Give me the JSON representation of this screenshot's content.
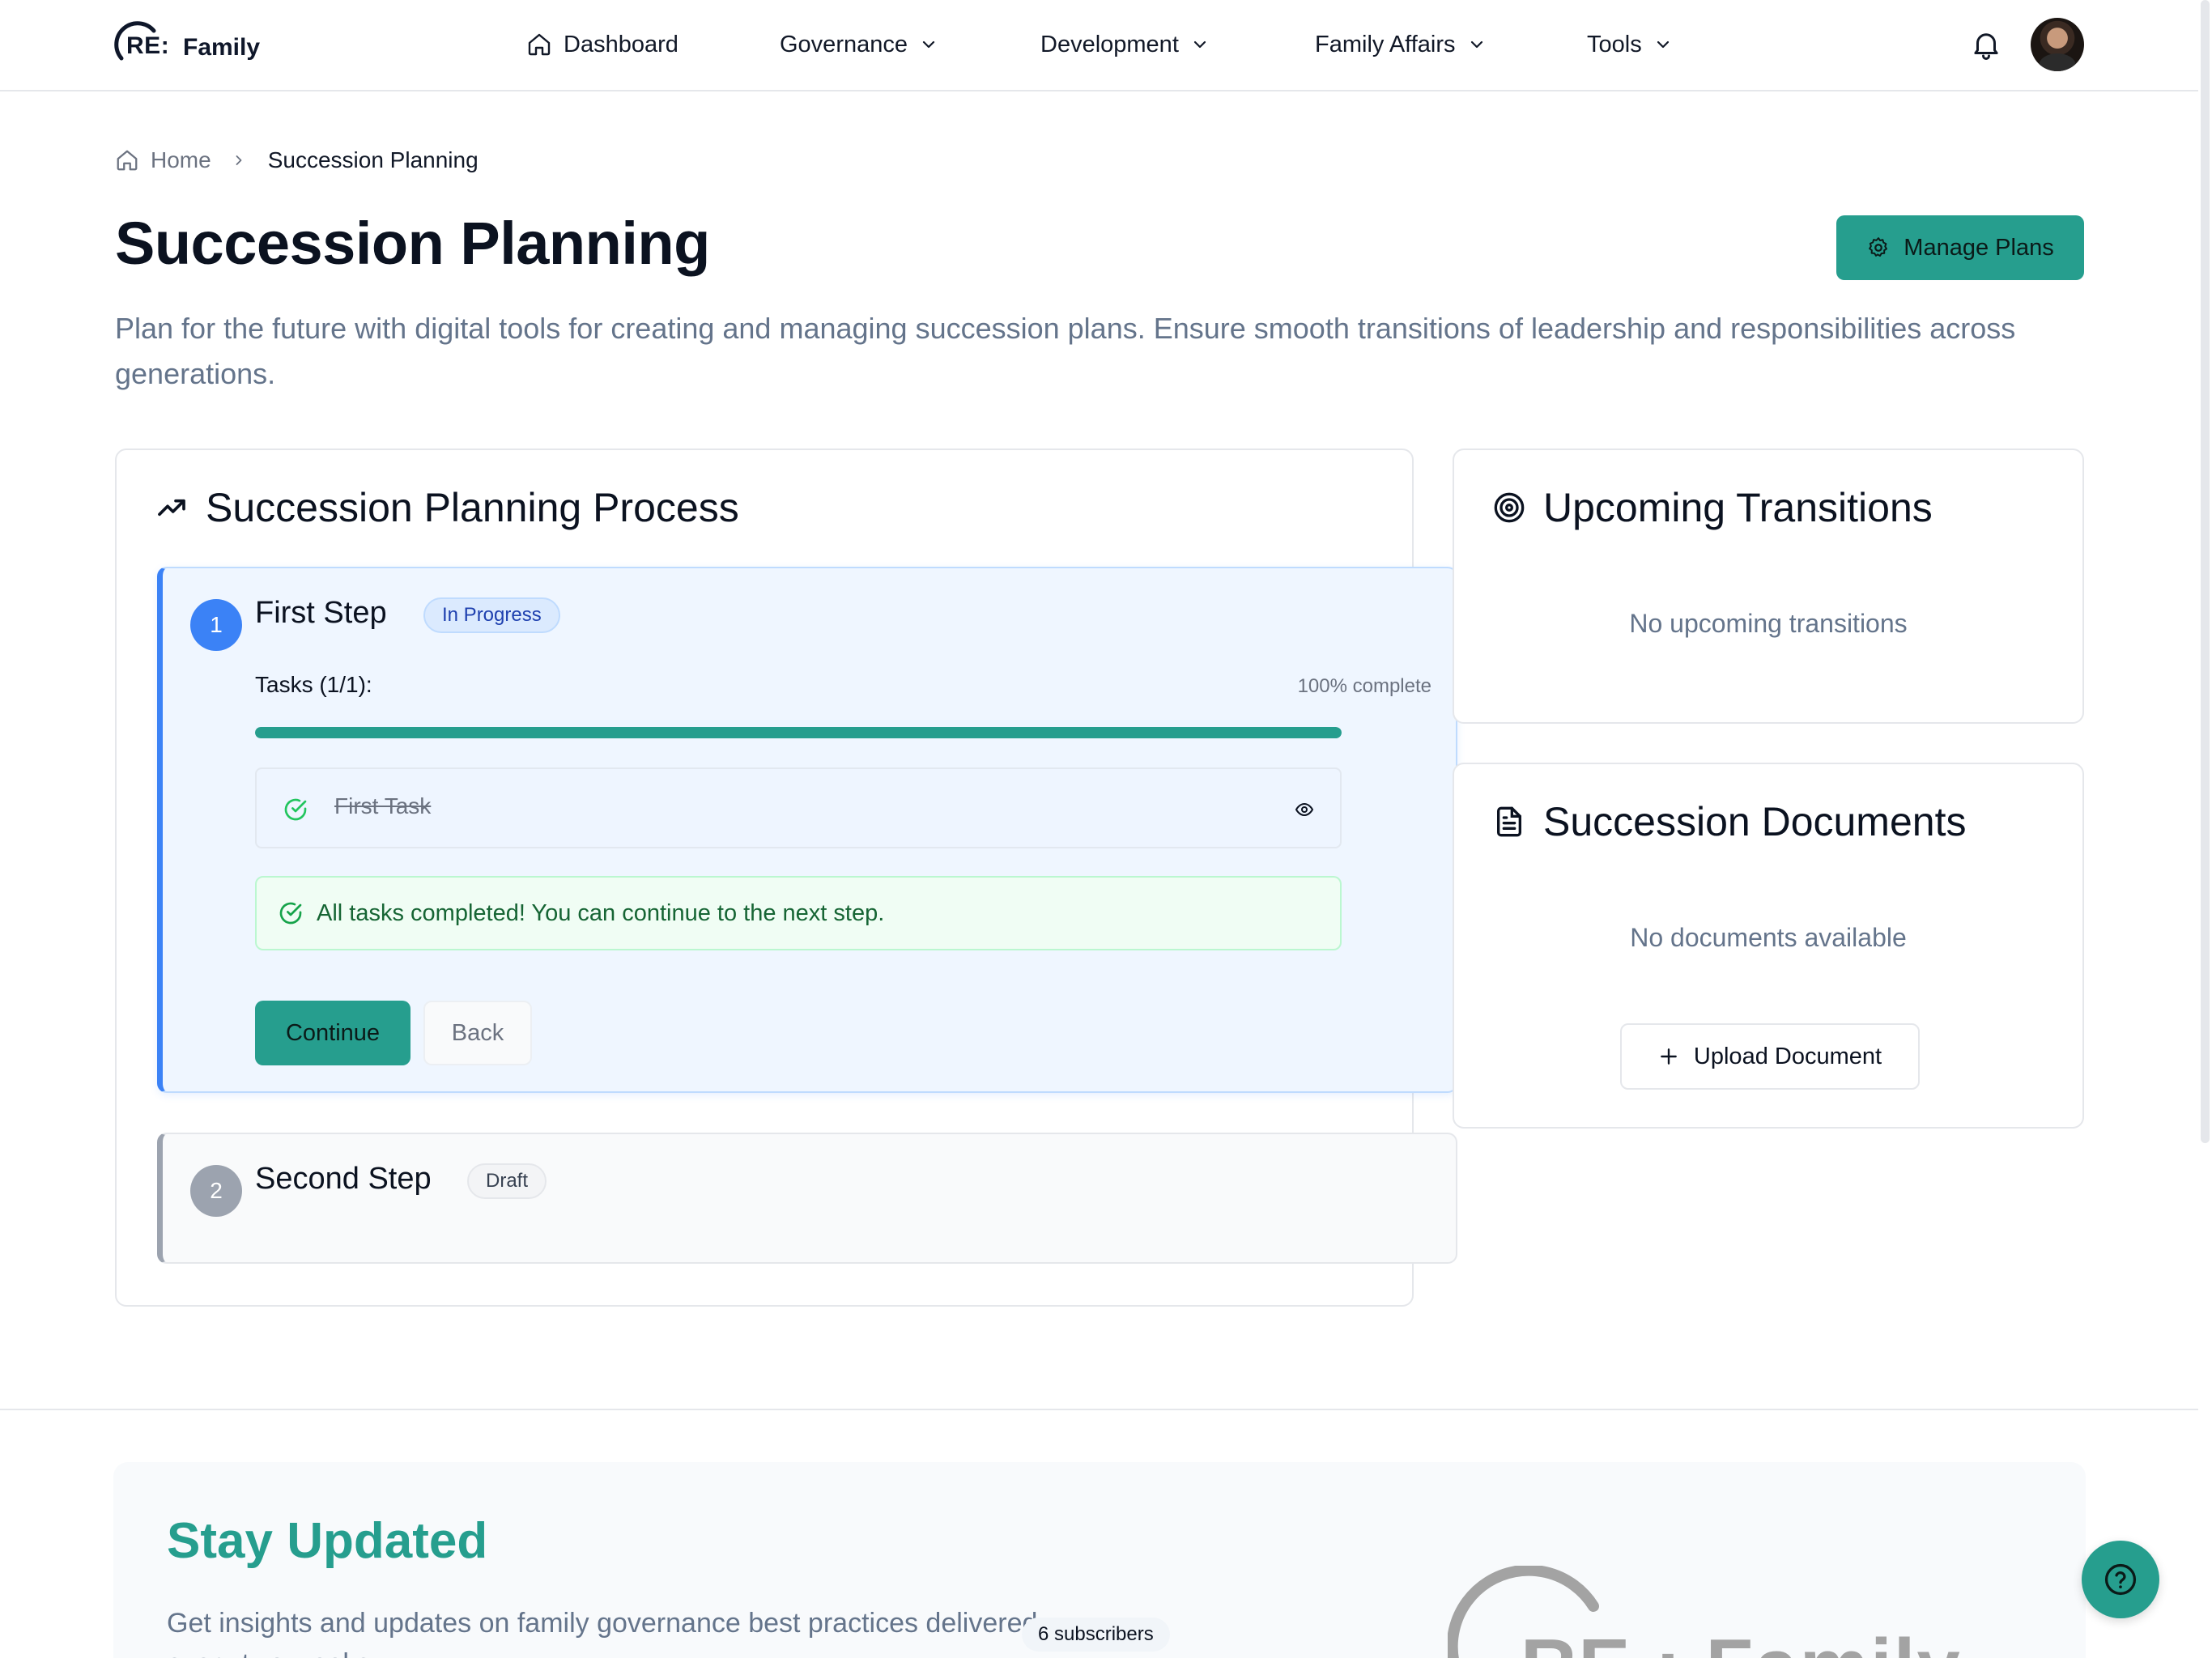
{
  "brand": {
    "re": "RE",
    "colon": ":",
    "family": "Family"
  },
  "nav": {
    "items": [
      {
        "label": "Dashboard",
        "icon": "home-icon"
      },
      {
        "label": "Governance",
        "icon": "chevron-down-icon"
      },
      {
        "label": "Development",
        "icon": "chevron-down-icon"
      },
      {
        "label": "Family Affairs",
        "icon": "chevron-down-icon"
      },
      {
        "label": "Tools",
        "icon": "chevron-down-icon"
      }
    ],
    "notifications_icon": "bell-icon",
    "avatar_icon": "user-avatar"
  },
  "breadcrumb": {
    "home": "Home",
    "current": "Succession Planning"
  },
  "page": {
    "title": "Succession Planning",
    "description": "Plan for the future with digital tools for creating and managing succession plans. Ensure smooth transitions of leadership and responsibilities across generations.",
    "manage_button": "Manage Plans"
  },
  "process": {
    "title": "Succession Planning Process",
    "steps": [
      {
        "number": "1",
        "title": "First Step",
        "status": "In Progress",
        "tasks_label": "Tasks (1/1):",
        "complete_label": "100% complete",
        "progress": 1.0,
        "tasks": [
          {
            "name": "First Task",
            "completed": true
          }
        ],
        "notice": "All tasks completed! You can continue to the next step.",
        "continue_label": "Continue",
        "back_label": "Back"
      },
      {
        "number": "2",
        "title": "Second Step",
        "status": "Draft"
      }
    ]
  },
  "transitions": {
    "title": "Upcoming Transitions",
    "empty": "No upcoming transitions"
  },
  "documents": {
    "title": "Succession Documents",
    "empty": "No documents available",
    "upload_label": "Upload Document"
  },
  "newsletter": {
    "title": "Stay Updated",
    "description": "Get insights and updates on family governance best practices delivered every two weeks.",
    "subscribers": "6 subscribers"
  },
  "colors": {
    "accent": "#269e8e",
    "step_active": "#3b82f6",
    "step_draft": "#9ca3af",
    "success": "#16a34a"
  }
}
